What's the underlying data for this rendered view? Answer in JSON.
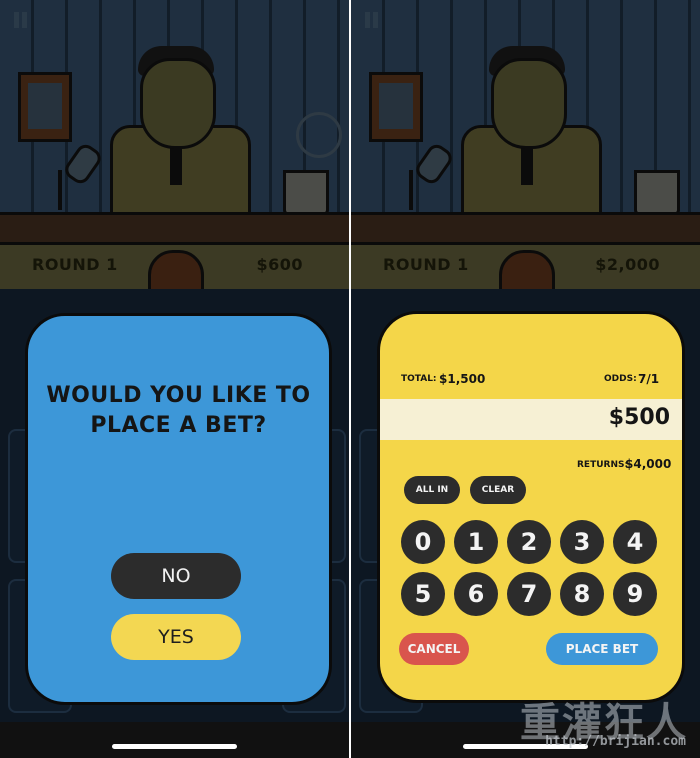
{
  "left_screen": {
    "round_label": "ROUND 1",
    "money": "$600",
    "dialog": {
      "question_line1": "WOULD YOU LIKE TO",
      "question_line2": "PLACE A BET?",
      "no_label": "NO",
      "yes_label": "YES",
      "background_color": "#3d97d8"
    }
  },
  "right_screen": {
    "round_label": "ROUND 1",
    "money": "$2,000",
    "bet_panel": {
      "total_label": "TOTAL:",
      "total_value": "$1,500",
      "odds_label": "ODDS:",
      "odds_value": "7/1",
      "bet_amount": "$500",
      "returns_label": "RETURNS:",
      "returns_value": "$4,000",
      "all_in_label": "ALL IN",
      "clear_label": "CLEAR",
      "keys": [
        "0",
        "1",
        "2",
        "3",
        "4",
        "5",
        "6",
        "7",
        "8",
        "9"
      ],
      "cancel_label": "CANCEL",
      "place_bet_label": "PLACE BET",
      "background_color": "#f4d649"
    }
  },
  "watermark": {
    "title": "重灌狂人",
    "url": "http://brijian.com"
  },
  "icons": [
    "pause-icon",
    "host-illustration",
    "microphone-icon",
    "mug-icon",
    "bell-icon",
    "picture-frame-icon"
  ]
}
